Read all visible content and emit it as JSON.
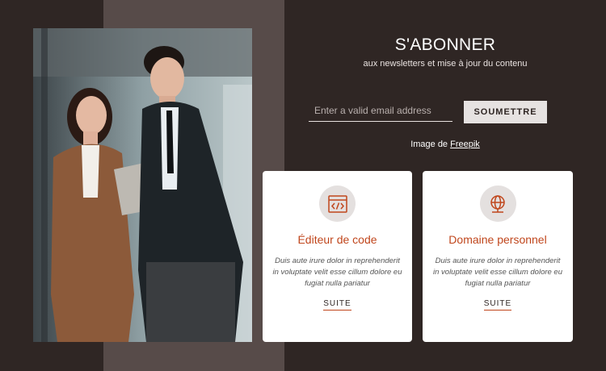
{
  "colors": {
    "background": "#2f2624",
    "band": "#574b49",
    "accent": "#c0461c",
    "button": "#e6e2e1",
    "card": "#ffffff"
  },
  "photo": {
    "description_icon": "photo-business-people"
  },
  "header": {
    "title": "S'ABONNER",
    "subtitle": "aux newsletters et mise à jour du contenu"
  },
  "form": {
    "email_placeholder": "Enter a valid email address",
    "email_value": "",
    "submit_label": "SOUMETTRE"
  },
  "credit": {
    "prefix": "Image de",
    "link_label": "Freepik"
  },
  "cards": [
    {
      "icon": "code-window-icon",
      "title": "Éditeur de code",
      "text": "Duis aute irure dolor in reprehenderit in voluptate velit esse cillum dolore eu fugiat nulla pariatur",
      "link": "SUITE"
    },
    {
      "icon": "globe-icon",
      "title": "Domaine personnel",
      "text": "Duis aute irure dolor in reprehenderit in voluptate velit esse cillum dolore eu fugiat nulla pariatur",
      "link": "SUITE"
    }
  ]
}
